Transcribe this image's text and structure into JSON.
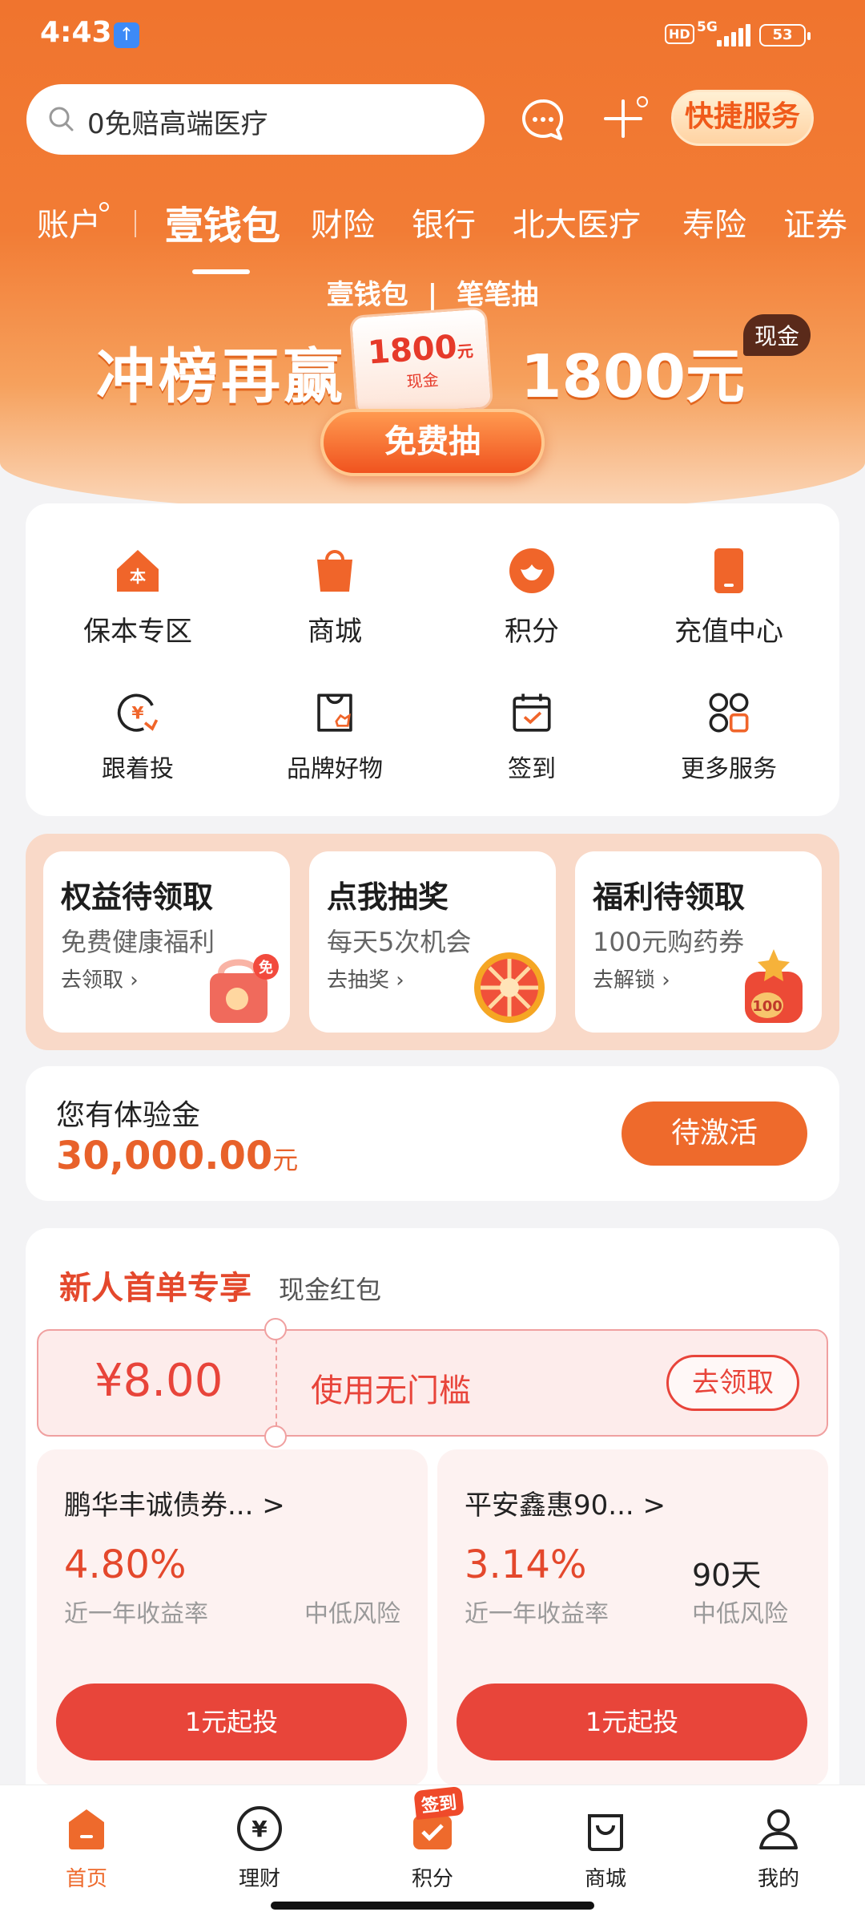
{
  "status_bar": {
    "time": "4:43",
    "network": "5G",
    "hd": "HD",
    "battery": "53"
  },
  "header": {
    "search_placeholder": "0免赔高端医疗",
    "quick_service_label": "快捷服务",
    "tabs": [
      {
        "label": "账户"
      },
      {
        "label": "壹钱包"
      },
      {
        "label": "财险"
      },
      {
        "label": "银行"
      },
      {
        "label": "北大医疗"
      },
      {
        "label": "寿险"
      },
      {
        "label": "证券"
      }
    ],
    "active_tab": "壹钱包"
  },
  "banner": {
    "brand": "壹钱包",
    "divider": "|",
    "sub_brand": "笔笔抽",
    "title": "冲榜再赢",
    "amount": "1800元",
    "cash_tag": "现金",
    "envelope_amount": "1800",
    "envelope_unit": "元",
    "envelope_sub": "现金",
    "button_label": "免费抽"
  },
  "services": {
    "row1": [
      {
        "label": "保本专区",
        "icon": "house-icon"
      },
      {
        "label": "商城",
        "icon": "shopping-bag-icon"
      },
      {
        "label": "积分",
        "icon": "points-icon"
      },
      {
        "label": "充值中心",
        "icon": "phone-icon"
      }
    ],
    "row2": [
      {
        "label": "跟着投",
        "icon": "invest-follow-icon"
      },
      {
        "label": "品牌好物",
        "icon": "brand-goods-icon"
      },
      {
        "label": "签到",
        "icon": "calendar-check-icon"
      },
      {
        "label": "更多服务",
        "icon": "grid-icon"
      }
    ]
  },
  "promos": [
    {
      "title": "权益待领取",
      "subtitle": "免费健康福利",
      "link": "去领取 ›"
    },
    {
      "title": "点我抽奖",
      "subtitle": "每天5次机会",
      "link": "去抽奖 ›"
    },
    {
      "title": "福利待领取",
      "subtitle": "100元购药券",
      "link": "去解锁 ›"
    }
  ],
  "experience": {
    "label": "您有体验金",
    "amount": "30,000.00",
    "unit": "元",
    "button": "待激活"
  },
  "new_user": {
    "title": "新人首单专享",
    "subtitle": "现金红包",
    "coupon": {
      "value": "¥8.00",
      "desc": "使用无门槛",
      "button": "去领取"
    },
    "funds": [
      {
        "name": "鹏华丰诚债券... >",
        "rate": "4.80%",
        "rate_label": "近一年收益率",
        "duration": "",
        "risk": "中低风险",
        "button": "1元起投"
      },
      {
        "name": "平安鑫惠90... >",
        "rate": "3.14%",
        "rate_label": "近一年收益率",
        "duration": "90天",
        "risk": "中低风险",
        "button": "1元起投"
      }
    ]
  },
  "bottom_nav": {
    "items": [
      {
        "label": "首页",
        "icon": "home-icon"
      },
      {
        "label": "理财",
        "icon": "yuan-icon"
      },
      {
        "label": "积分",
        "icon": "points-bag-icon"
      },
      {
        "label": "商城",
        "icon": "mall-bag-icon"
      },
      {
        "label": "我的",
        "icon": "user-icon"
      }
    ],
    "points_badge": "签到",
    "active": "首页"
  },
  "colors": {
    "brand_orange": "#f0742e",
    "accent_red": "#e8453a",
    "active_nav": "#ee6a2c"
  }
}
